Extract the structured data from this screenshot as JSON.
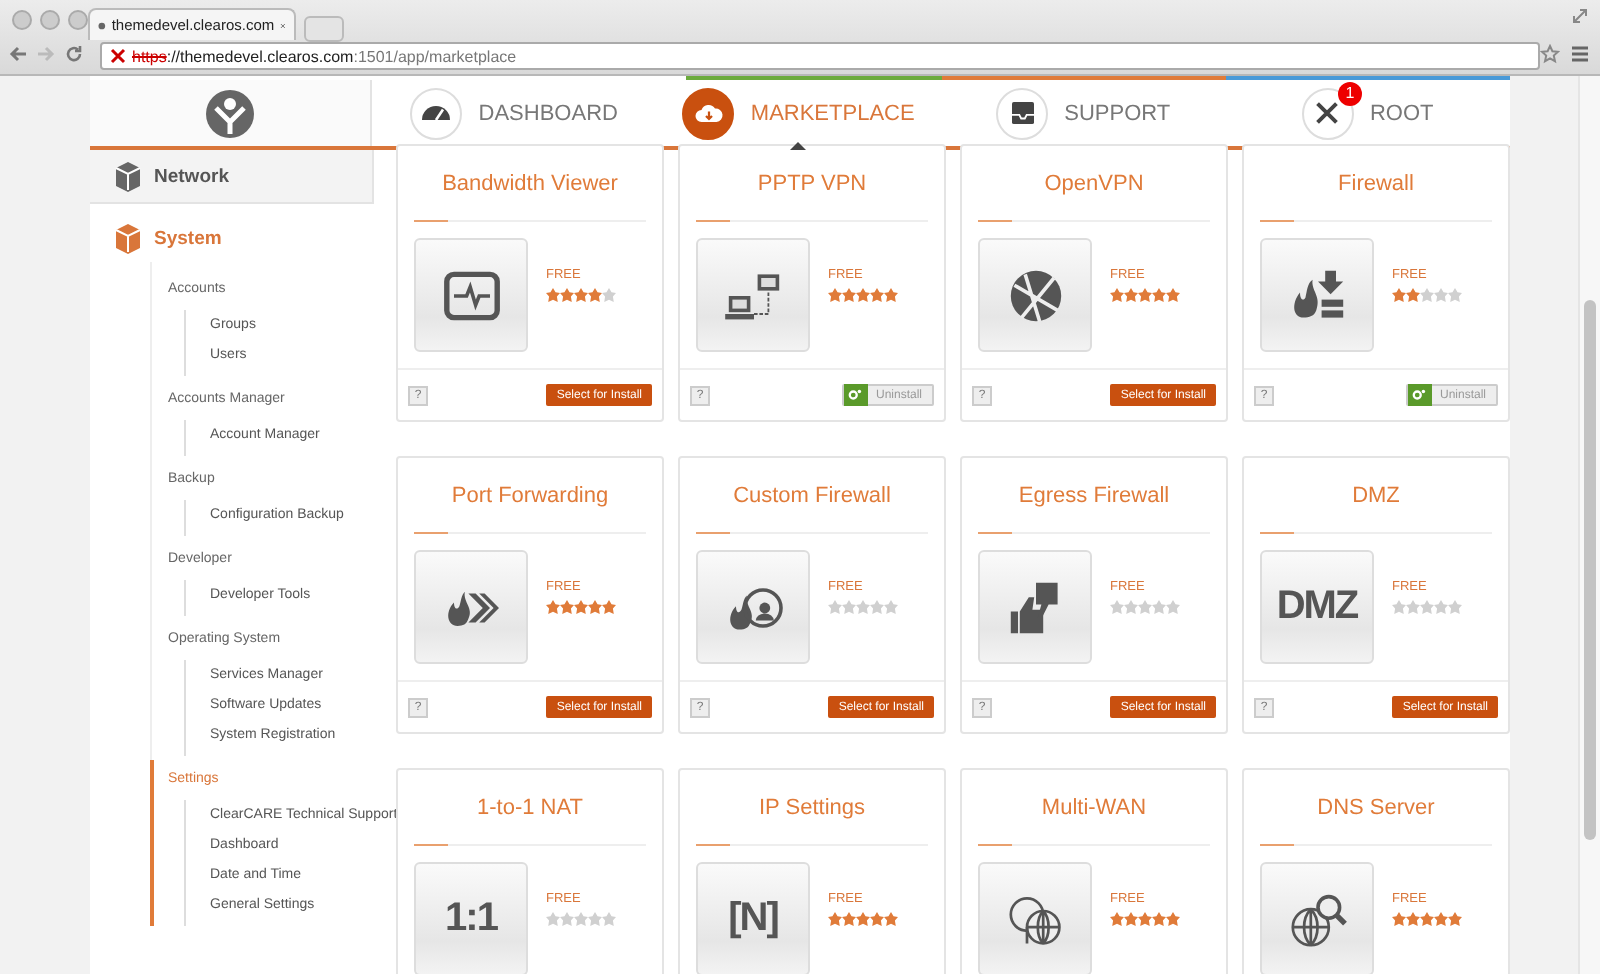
{
  "browser": {
    "tab_title": "themedevel.clearos.com",
    "url_scheme": "https",
    "url_host": "://themedevel.clearos.com",
    "url_path": ":1501/app/marketplace"
  },
  "nav": [
    {
      "label": "DASHBOARD",
      "selected": false
    },
    {
      "label": "MARKETPLACE",
      "selected": true
    },
    {
      "label": "SUPPORT",
      "selected": false
    },
    {
      "label": "ROOT",
      "selected": false,
      "badge": "1"
    }
  ],
  "sidebar": {
    "sections": [
      {
        "label": "Network",
        "selected": false
      },
      {
        "label": "System",
        "selected": true
      }
    ],
    "groups": [
      {
        "label": "Accounts",
        "selected": false,
        "items": [
          "Groups",
          "Users"
        ]
      },
      {
        "label": "Accounts Manager",
        "selected": false,
        "items": [
          "Account Manager"
        ]
      },
      {
        "label": "Backup",
        "selected": false,
        "items": [
          "Configuration Backup"
        ]
      },
      {
        "label": "Developer",
        "selected": false,
        "items": [
          "Developer Tools"
        ]
      },
      {
        "label": "Operating System",
        "selected": false,
        "items": [
          "Services Manager",
          "Software Updates",
          "System Registration"
        ]
      },
      {
        "label": "Settings",
        "selected": true,
        "items": [
          "ClearCARE Technical Support",
          "Dashboard",
          "Date and Time",
          "General Settings"
        ]
      }
    ]
  },
  "apps": [
    {
      "title": "Bandwidth Viewer",
      "price": "FREE",
      "stars": 4,
      "help": "?",
      "action": {
        "kind": "install",
        "label": "Select for Install"
      }
    },
    {
      "title": "PPTP VPN",
      "price": "FREE",
      "stars": 5,
      "help": "?",
      "action": {
        "kind": "uninstall",
        "label": "Uninstall"
      }
    },
    {
      "title": "OpenVPN",
      "price": "FREE",
      "stars": 5,
      "help": "?",
      "action": {
        "kind": "install",
        "label": "Select for Install"
      }
    },
    {
      "title": "Firewall",
      "price": "FREE",
      "stars": 2,
      "help": "?",
      "action": {
        "kind": "uninstall",
        "label": "Uninstall"
      }
    },
    {
      "title": "Port Forwarding",
      "price": "FREE",
      "stars": 5,
      "help": "?",
      "action": {
        "kind": "install",
        "label": "Select for Install"
      }
    },
    {
      "title": "Custom Firewall",
      "price": "FREE",
      "stars": 0,
      "help": "?",
      "action": {
        "kind": "install",
        "label": "Select for Install"
      }
    },
    {
      "title": "Egress Firewall",
      "price": "FREE",
      "stars": 0,
      "help": "?",
      "action": {
        "kind": "install",
        "label": "Select for Install"
      }
    },
    {
      "title": "DMZ",
      "icon_text": "DMZ",
      "price": "FREE",
      "stars": 0,
      "help": "?",
      "action": {
        "kind": "install",
        "label": "Select for Install"
      }
    },
    {
      "title": "1-to-1 NAT",
      "icon_text": "1:1",
      "price": "FREE",
      "stars": 0
    },
    {
      "title": "IP Settings",
      "icon_text": "[N]",
      "price": "FREE",
      "stars": 5
    },
    {
      "title": "Multi-WAN",
      "price": "FREE",
      "stars": 5
    },
    {
      "title": "DNS Server",
      "price": "FREE",
      "stars": 5
    }
  ]
}
